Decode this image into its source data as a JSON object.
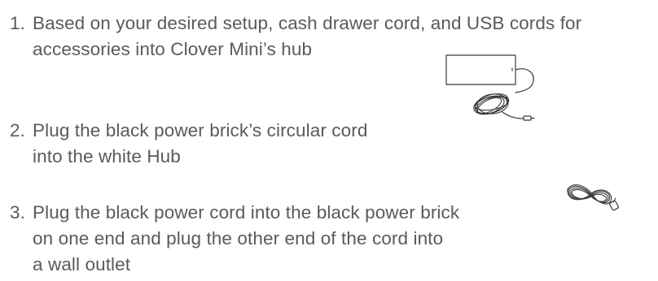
{
  "steps": [
    {
      "number": "1.",
      "lines": [
        "Based on your desired setup, cash drawer cord, and USB cords for",
        "accessories into Clover Mini’s hub"
      ]
    },
    {
      "number": "2.",
      "lines": [
        "Plug the black power brick’s circular cord",
        "into the white Hub"
      ]
    },
    {
      "number": "3.",
      "lines": [
        "Plug the black power cord into the black power brick",
        "on one end and plug the other end of the cord into",
        "a wall outlet"
      ]
    }
  ],
  "illustrations": {
    "power_brick": "power-brick-icon",
    "power_cord": "power-cord-icon"
  }
}
